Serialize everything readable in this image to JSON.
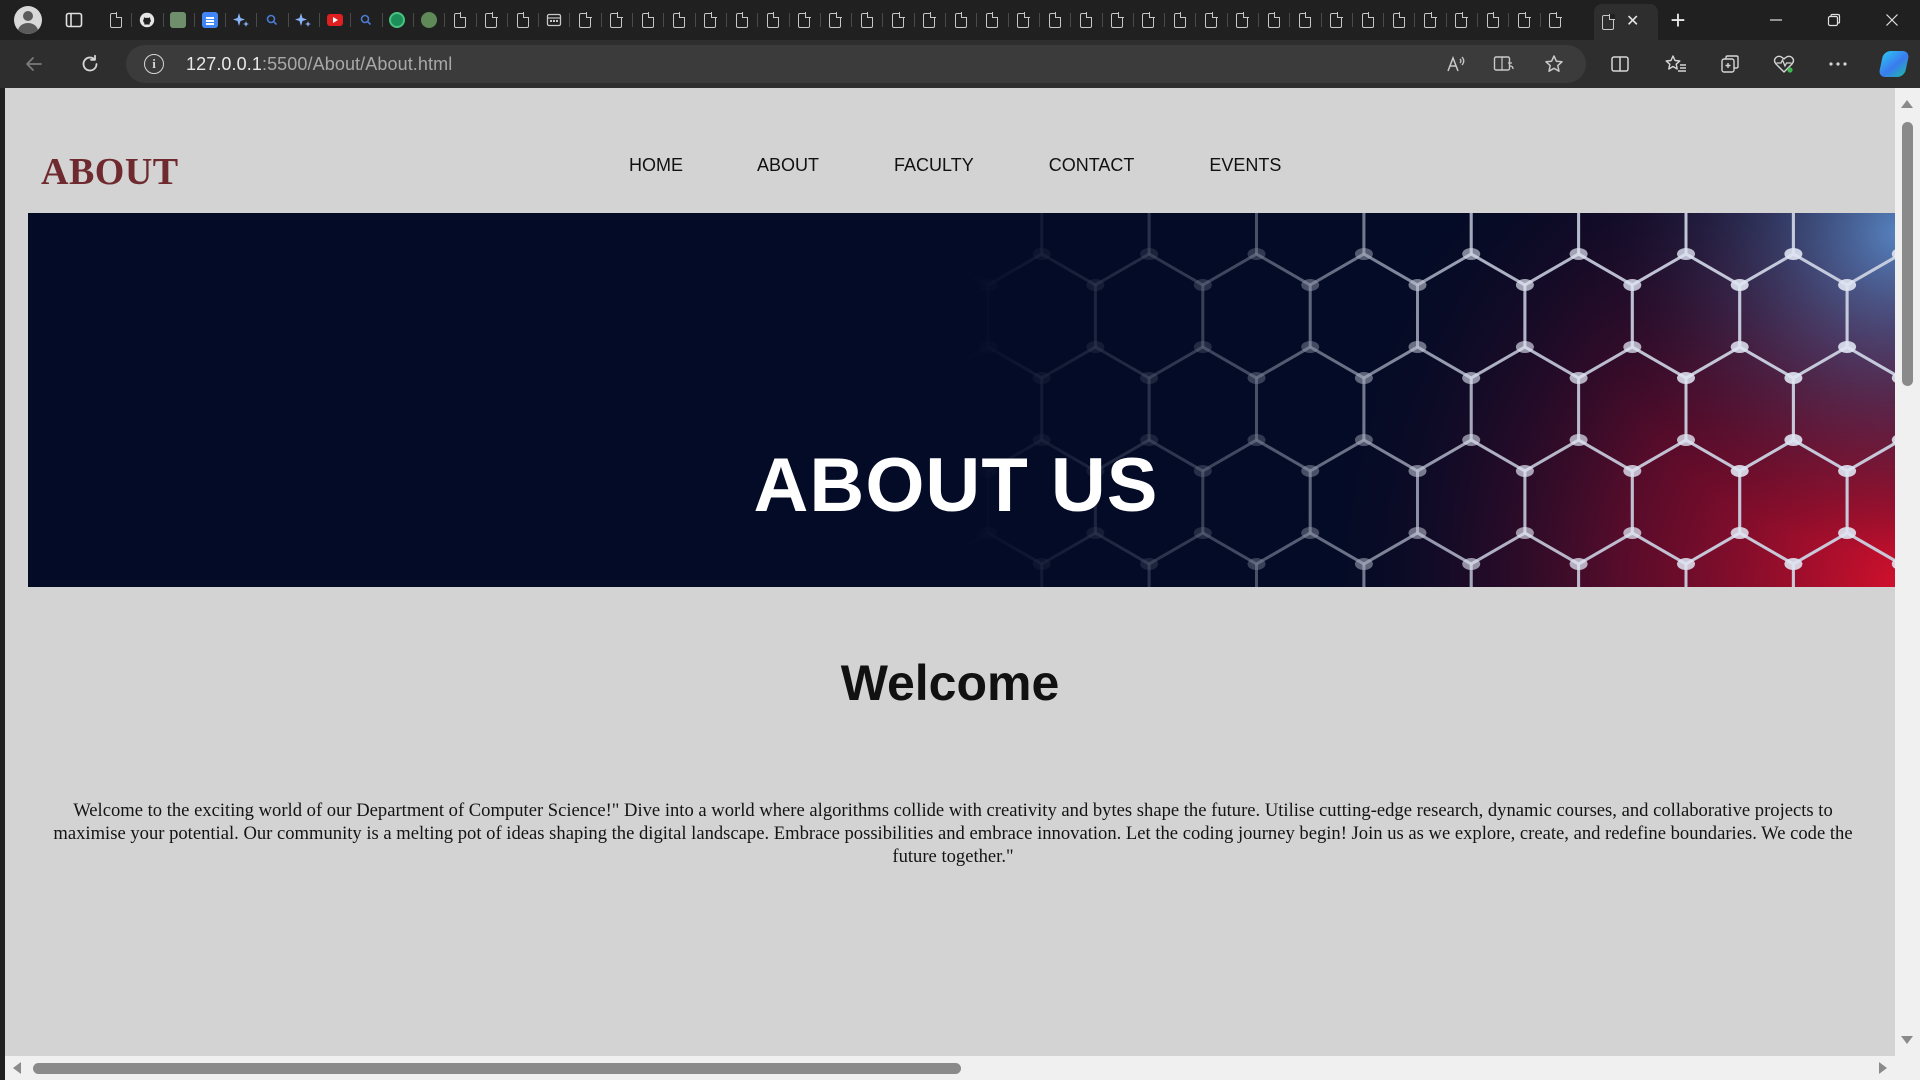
{
  "browser": {
    "address": {
      "url_host": "127.0.0.1",
      "url_rest": ":5500/About/About.html"
    },
    "tab_icons": [
      "doc",
      "github",
      "page",
      "docs",
      "sparkle",
      "search",
      "sparkle",
      "youtube",
      "search",
      "g",
      "g-green",
      "doc",
      "doc",
      "doc",
      "calendar",
      "doc",
      "doc",
      "doc",
      "doc",
      "doc",
      "doc",
      "doc",
      "doc",
      "doc",
      "doc",
      "doc",
      "doc",
      "doc",
      "doc",
      "doc",
      "doc",
      "doc",
      "doc",
      "doc",
      "doc",
      "doc",
      "doc",
      "doc",
      "doc",
      "doc",
      "doc",
      "doc",
      "doc",
      "doc",
      "doc",
      "doc",
      "doc"
    ],
    "colors": {
      "tabbar": "#202020",
      "toolbar": "#2e2e2e",
      "addressbar": "#3b3b3b"
    }
  },
  "site": {
    "logo": "ABOUT",
    "nav": [
      "HOME",
      "ABOUT",
      "FACULTY",
      "CONTACT",
      "EVENTS"
    ],
    "hero_title": "ABOUT US",
    "welcome_heading": "Welcome",
    "welcome_text": "Welcome to the exciting world of our Department of Computer Science!\" Dive into a world where algorithms collide with creativity and bytes shape the future. Utilise cutting-edge research, dynamic courses, and collaborative projects to maximise your potential. Our community is a melting pot of ideas shaping the digital landscape. Embrace possibilities and embrace innovation. Let the coding journey begin! Join us as we explore, create, and redefine boundaries. We code the future together.\"",
    "colors": {
      "page_bg": "#d3d3d3",
      "logo": "#6e2a2f",
      "hero_bg": "#030b26",
      "hero_accent": "#c8102e"
    }
  }
}
